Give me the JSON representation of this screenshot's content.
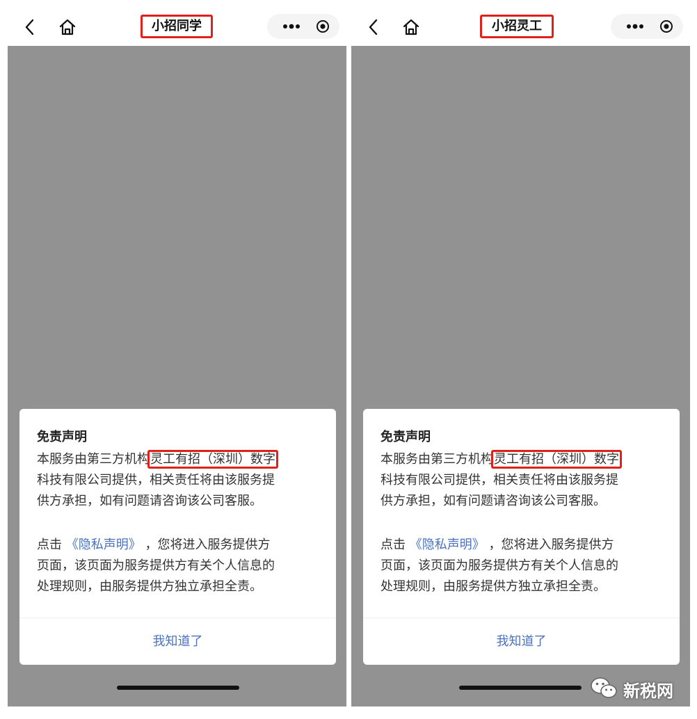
{
  "left": {
    "title": "小招同学",
    "dialog": {
      "title": "免责声明",
      "p1_prefix": "本服务由第三方机构",
      "p1_highlight": "灵工有招（深圳）数字",
      "p1_line2": "科技有限公司提供，相关责任将由该服务提",
      "p1_line3": "供方承担，如有问题请咨询该公司客服。",
      "p2_prefix": "点击",
      "p2_link": "《隐私声明》",
      "p2_suffix": "，您将进入服务提供方",
      "p2_line2": "页面，该页面为服务提供方有关个人信息的",
      "p2_line3": "处理规则，由服务提供方独立承担全责。",
      "confirm": "我知道了"
    }
  },
  "right": {
    "title": "小招灵工",
    "dialog": {
      "title": "免责声明",
      "p1_prefix": "本服务由第三方机构",
      "p1_highlight": "灵工有招（深圳）数字",
      "p1_line2": "科技有限公司提供，相关责任将由该服务提",
      "p1_line3": "供方承担，如有问题请咨询该公司客服。",
      "p2_prefix": "点击",
      "p2_link": "《隐私声明》",
      "p2_suffix": "，您将进入服务提供方",
      "p2_line2": "页面，该页面为服务提供方有关个人信息的",
      "p2_line3": "处理规则，由服务提供方独立承担全责。",
      "confirm": "我知道了"
    }
  },
  "watermark": "新税网",
  "colors": {
    "highlight_border": "#e0201a",
    "link": "#4a72c0",
    "overlay": "#929292"
  },
  "icons": {
    "back": "chevron-left-icon",
    "home": "home-icon",
    "more": "more-dots-icon",
    "close": "target-circle-icon",
    "watermark_logo": "wechat-icon"
  }
}
